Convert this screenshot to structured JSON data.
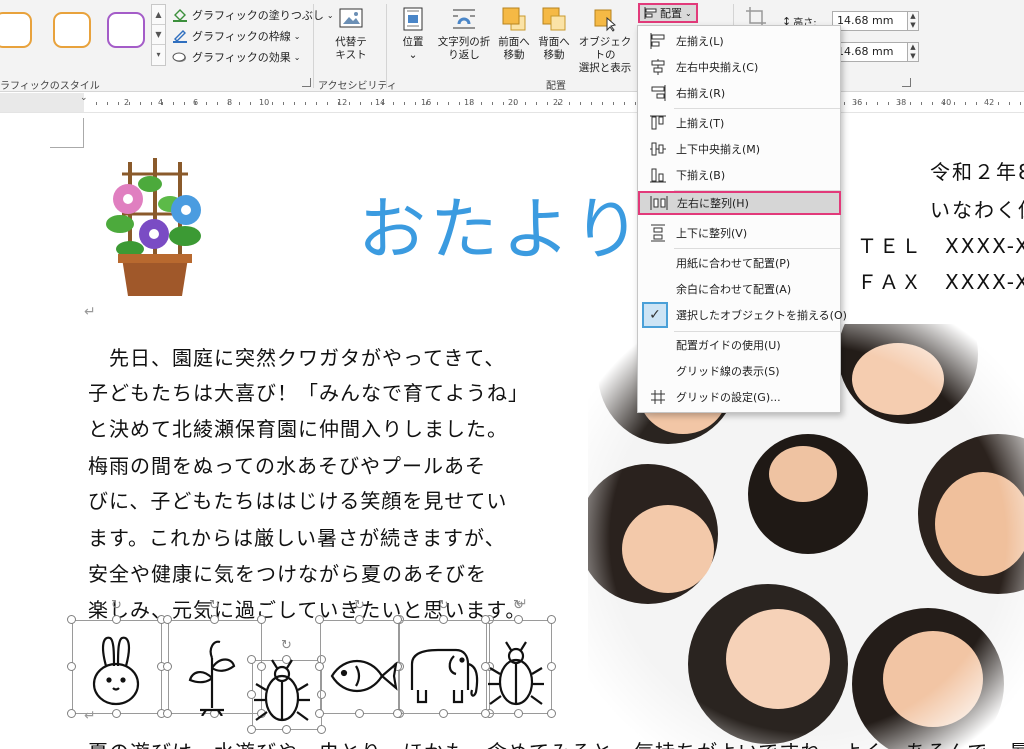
{
  "ribbon": {
    "groups": {
      "shape_styles": "ラフィックのスタイル",
      "accessibility": "アクセシビリティ",
      "arrange": "配置"
    },
    "shape_commands": {
      "fill": "グラフィックの塗りつぶし",
      "outline": "グラフィックの枠線",
      "effects": "グラフィックの効果"
    },
    "alt_text": [
      "代替テ",
      "キスト"
    ],
    "position": [
      "位置"
    ],
    "wrap_text": [
      "文字列の折",
      "り返し"
    ],
    "bring_forward": [
      "前面へ",
      "移動"
    ],
    "send_backward": [
      "背面へ",
      "移動"
    ],
    "selection_pane": [
      "オブジェクトの",
      "選択と表示"
    ],
    "arrange_button": "配置",
    "height_label": "高さ:",
    "height_value": "14.68 mm",
    "width_value": "14.68 mm",
    "style_colors": [
      "#e8a23c",
      "#e8a23c",
      "#a45cc8"
    ]
  },
  "ruler": {
    "labels": [
      "2",
      "4",
      "6",
      "8",
      "10",
      "12",
      "14",
      "16",
      "18",
      "20",
      "22",
      "36",
      "38",
      "40",
      "42"
    ]
  },
  "arrange_menu": {
    "items": [
      {
        "label": "左揃え(L)",
        "icon": "align-left-icon"
      },
      {
        "label": "左右中央揃え(C)",
        "icon": "align-center-icon"
      },
      {
        "label": "右揃え(R)",
        "icon": "align-right-icon"
      },
      {
        "label": "上揃え(T)",
        "icon": "align-top-icon"
      },
      {
        "label": "上下中央揃え(M)",
        "icon": "align-middle-icon"
      },
      {
        "label": "下揃え(B)",
        "icon": "align-bottom-icon"
      },
      {
        "label": "左右に整列(H)",
        "icon": "distribute-horizontal-icon"
      },
      {
        "label": "上下に整列(V)",
        "icon": "distribute-vertical-icon"
      },
      {
        "label": "用紙に合わせて配置(P)",
        "icon": ""
      },
      {
        "label": "余白に合わせて配置(A)",
        "icon": ""
      },
      {
        "label": "選択したオブジェクトを揃える(O)",
        "icon": "check-icon"
      },
      {
        "label": "配置ガイドの使用(U)",
        "icon": ""
      },
      {
        "label": "グリッド線の表示(S)",
        "icon": ""
      },
      {
        "label": "グリッドの設定(G)...",
        "icon": "grid-icon"
      }
    ],
    "highlighted": "左右に整列(H)",
    "checked": "選択したオブジェクトを揃える(O)"
  },
  "document": {
    "title": "おたより",
    "date_partial": "令和２年8",
    "school_partial": "いなわく保",
    "tel": "ＴＥＬ　XXXX-X",
    "fax": "ＦＡＸ　XXXX-X",
    "paragraph": [
      "　先日、園庭に突然クワガタがやってきて、",
      "子どもたちは大喜び！「みんなで育てようね」",
      "と決めて北綾瀬保育園に仲間入りしました。",
      "梅雨の間をぬっての水あそびやプールあそ",
      "びに、子どもたちははじける笑顔を見せてい",
      "ます。これからは厳しい暑さが続きますが、",
      "安全や健康に気をつけながら夏のあそびを",
      "楽しみ、元気に過ごしていきたいと思います。"
    ],
    "bottom_line_partial": "夏の遊びは　水遊びや　虫とり・ほかも　含めてみると　気持ちがよいですね　よく　あそんで　暑さに負けないからだを"
  },
  "icons_selected": [
    "rabbit-icon",
    "plant-icon",
    "beetle-icon",
    "fish-icon",
    "elephant-icon",
    "beetle-icon"
  ]
}
